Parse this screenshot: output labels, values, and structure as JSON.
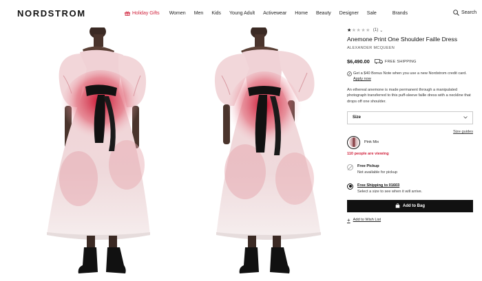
{
  "header": {
    "logo": "NORDSTROM",
    "nav": [
      {
        "label": "Holiday Gifts",
        "name": "nav-holiday-gifts"
      },
      {
        "label": "Women",
        "name": "nav-women"
      },
      {
        "label": "Men",
        "name": "nav-men"
      },
      {
        "label": "Kids",
        "name": "nav-kids"
      },
      {
        "label": "Young Adult",
        "name": "nav-young-adult"
      },
      {
        "label": "Activewear",
        "name": "nav-activewear"
      },
      {
        "label": "Home",
        "name": "nav-home"
      },
      {
        "label": "Beauty",
        "name": "nav-beauty"
      },
      {
        "label": "Designer",
        "name": "nav-designer"
      },
      {
        "label": "Sale",
        "name": "nav-sale"
      },
      {
        "label": "Brands",
        "name": "nav-brands"
      }
    ],
    "search_label": "Search",
    "holiday_color": "#d0213b"
  },
  "product": {
    "rating_stars": 1,
    "rating_max": 5,
    "review_count": "(1)",
    "title": "Anemone Print One Shoulder Faille Dress",
    "brand": "ALEXANDER MCQUEEN",
    "price": "$6,490.00",
    "free_shipping": "FREE SHIPPING",
    "promo_text": "Get a $40 Bonus Note when you use a new Nordstrom credit card.",
    "apply_link": "Apply now",
    "description": "An ethereal anemone is made permanent through a manipulated photograph transferred to this puff-sleeve faille dress with a neckline that drops off one shoulder.",
    "size_label": "Size",
    "size_guides": "Size guides",
    "color_name": "Pink Mix",
    "viewing_text": "110 people are viewing",
    "pickup_title": "Free Pickup",
    "pickup_sub": "Not available for pickup",
    "shipping_title": "Free Shipping to 01603",
    "shipping_sub": "Select a size to see when it will arrive.",
    "add_to_bag": "Add to Bag",
    "wishlist": "Add to Wish List"
  }
}
